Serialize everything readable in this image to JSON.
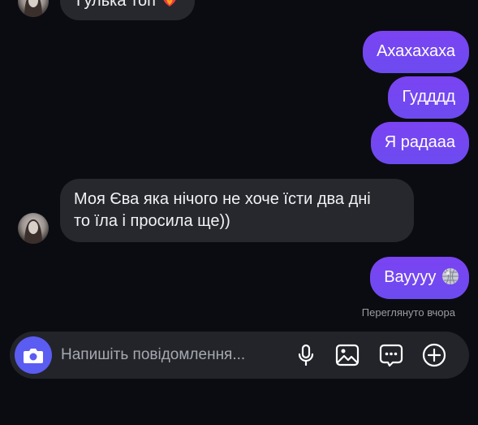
{
  "messages": {
    "top_partial_text": "Гулька топ",
    "out_1": "Ахахахаха",
    "out_2": "Гудддд",
    "out_3": "Я радааа",
    "in_1_line_1": "Моя Єва яка нічого не хоче їсти два дні",
    "in_1_line_2": "то їла і просила ще))",
    "out_4": "Вауууу",
    "emoji_top": "heart-on-fire-emoji",
    "emoji_last": "disco-ball-emoji"
  },
  "status": {
    "seen": "Переглянуто вчора"
  },
  "composer": {
    "placeholder": "Напишіть повідомлення...",
    "icons": [
      "camera-icon",
      "microphone-icon",
      "gallery-icon",
      "sticker-icon",
      "plus-icon"
    ]
  },
  "colors": {
    "background": "#0b0c11",
    "incoming_bubble": "#26282e",
    "outgoing_bubble": "#7b43f2",
    "camera_button": "#5b5cf2",
    "seen_text": "#9a9ca3"
  }
}
